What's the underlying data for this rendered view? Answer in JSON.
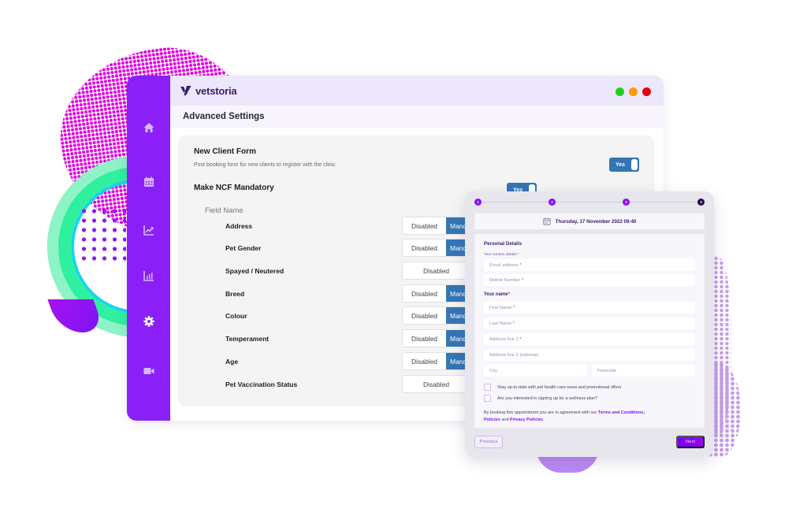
{
  "app": {
    "brand": "vetstoria",
    "window_controls": [
      {
        "name": "maximize",
        "color": "#1ed01e"
      },
      {
        "name": "minimize",
        "color": "#ff9a00"
      },
      {
        "name": "close",
        "color": "#e60012"
      }
    ]
  },
  "colors": {
    "sidebar": "#8a1ff7",
    "accent_blue": "#3475b5",
    "form_purple": "#8a0ff5"
  },
  "sidebar": {
    "items": [
      {
        "icon": "home-icon",
        "label": "Home"
      },
      {
        "icon": "calendar-icon",
        "label": "Calendar"
      },
      {
        "icon": "trend-chart-icon",
        "label": "Analytics"
      },
      {
        "icon": "bar-chart-icon",
        "label": "Reports"
      },
      {
        "icon": "gear-icon",
        "label": "Settings",
        "active": true
      },
      {
        "icon": "video-icon",
        "label": "Video"
      }
    ]
  },
  "page": {
    "title": "Advanced Settings"
  },
  "settings": {
    "new_client_form": {
      "title": "New Client Form",
      "description": "Post booking form for new clients to register with the clinic",
      "toggle_label": "Yes",
      "enabled": true
    },
    "make_mandatory": {
      "title": "Make NCF Mandatory",
      "toggle_label": "Yes",
      "enabled": true
    },
    "field_header": "Field Name",
    "option_disabled": "Disabled",
    "option_mandatory": "Mandatory",
    "fields": [
      {
        "label": "Address",
        "state": "Mandatory"
      },
      {
        "label": "Pet Gender",
        "state": "Mandatory"
      },
      {
        "label": "Spayed / Neutered",
        "state": "Disabled"
      },
      {
        "label": "Breed",
        "state": "Mandatory"
      },
      {
        "label": "Colour",
        "state": "Mandatory"
      },
      {
        "label": "Temperament",
        "state": "Mandatory"
      },
      {
        "label": "Age",
        "state": "Mandatory"
      },
      {
        "label": "Pet Vaccination Status",
        "state": "Disabled"
      }
    ]
  },
  "booking_form": {
    "steps": [
      "1",
      "2",
      "3",
      "4"
    ],
    "current_step": 4,
    "datetime": "Thursday, 17 November 2022 09:40",
    "section_title": "Personal Details",
    "contact_label": "Your contact details",
    "email_placeholder": "Email address",
    "mobile_placeholder": "Mobile Number",
    "name_label": "Your name",
    "first_name_placeholder": "First Name",
    "last_name_placeholder": "Last Name",
    "address1_placeholder": "Address line 1",
    "address2_placeholder": "Address line 2 (optional)",
    "city_placeholder": "City",
    "postcode_placeholder": "Postcode",
    "required_mark": "*",
    "checkbox_news": "Stay up-to-date with pet health care news and promotional offers",
    "checkbox_wellness": "Are you interested in signing up for a wellness plan?",
    "terms_prefix": "By booking this appointment you are in agreement with our",
    "terms_link": "Terms and Conditions,",
    "policies_link": "Policies",
    "terms_and": "and",
    "privacy_link": "Privacy Policies",
    "previous_label": "Previous",
    "next_label": "Next"
  }
}
